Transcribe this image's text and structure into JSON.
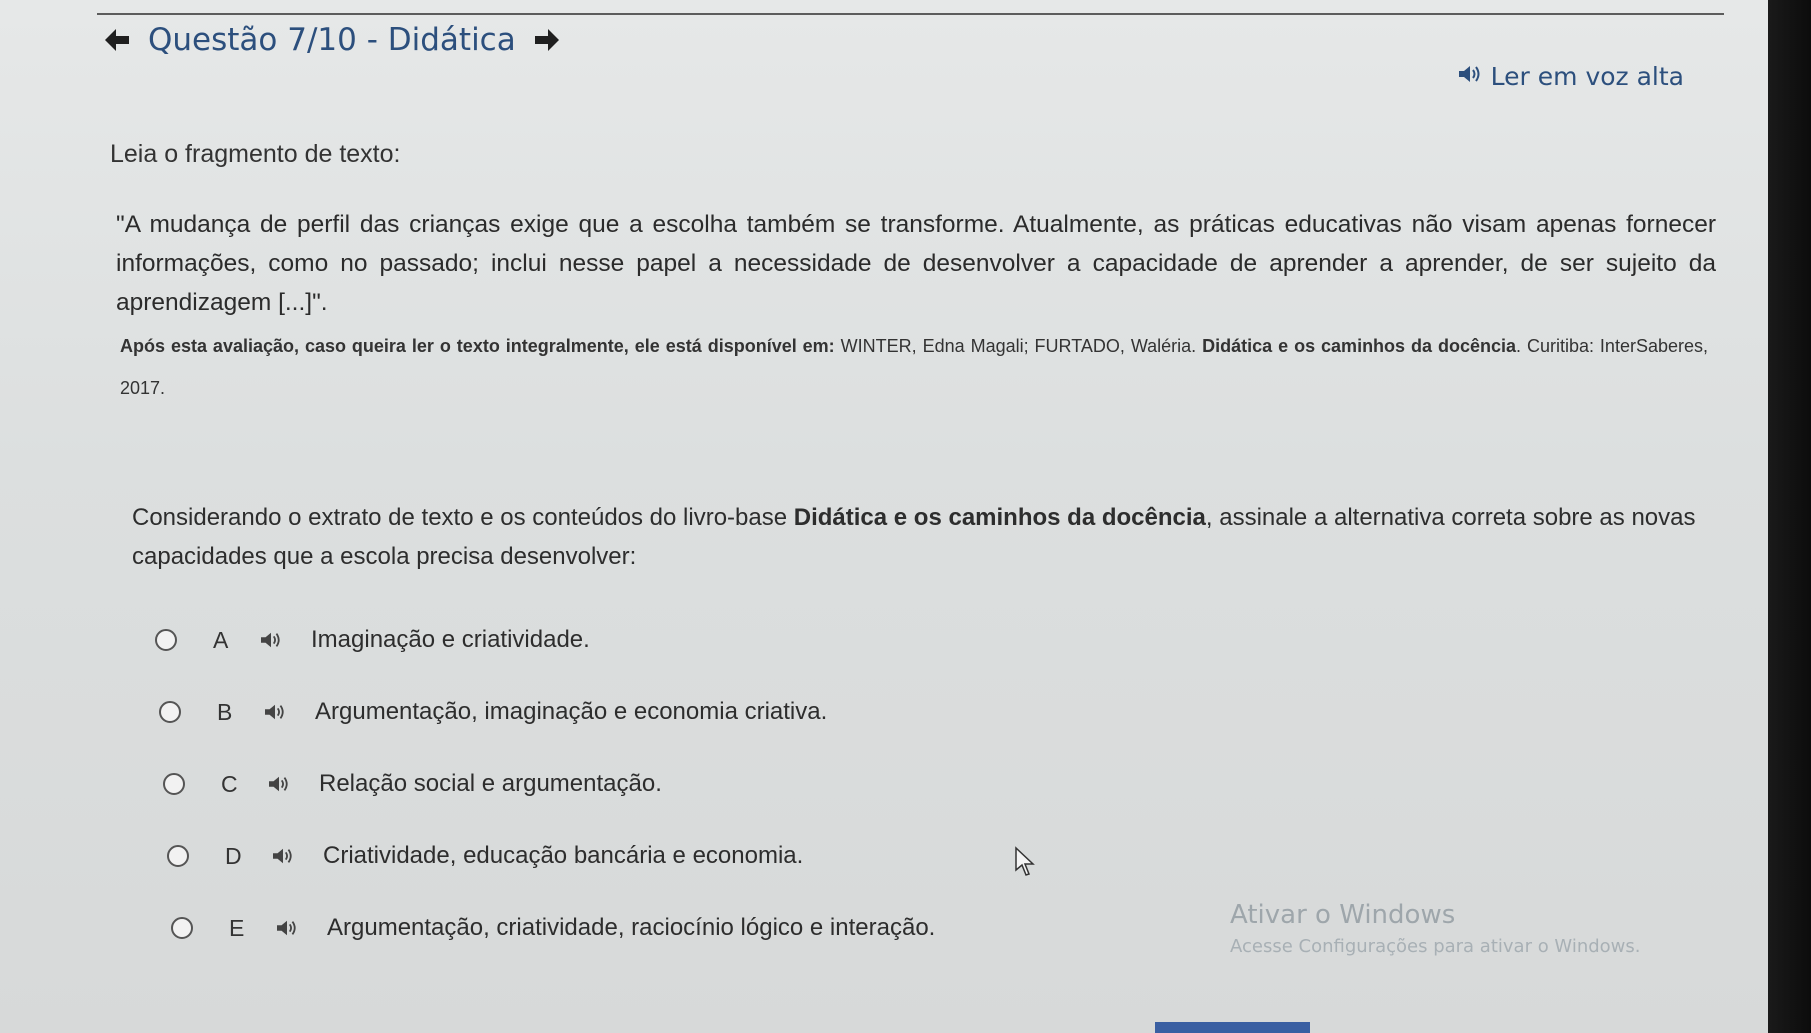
{
  "header": {
    "title": "Questão 7/10 - Didática",
    "prev_icon": "arrow-left-icon",
    "next_icon": "arrow-right-icon"
  },
  "read_aloud": {
    "label": "Ler em voz alta",
    "icon": "speaker-icon"
  },
  "question": {
    "intro": "Leia o fragmento de texto:",
    "quote": "\"A mudança de perfil das crianças exige que a escolha também se transforme. Atualmente, as práticas educativas não visam apenas fornecer informações, como no passado; inclui nesse papel a necessidade de desenvolver a capacidade de aprender a aprender, de ser sujeito da aprendizagem [...]\".",
    "source_bold": "Após esta avaliação, caso queira ler o texto integralmente, ele está disponível em:",
    "source_plain": " WINTER, Edna Magali; FURTADO, Waléria. ",
    "source_title": "Didática e os caminhos da docência",
    "source_end": ". Curitiba: InterSaberes, 2017.",
    "statement_start": "Considerando o extrato de texto e os conteúdos do livro-base ",
    "statement_bold": "Didática e os caminhos da docência",
    "statement_end": ", assinale a alternativa correta sobre as novas capacidades que a escola precisa desenvolver:"
  },
  "alternatives": [
    {
      "letter": "A",
      "text": "Imaginação e criatividade."
    },
    {
      "letter": "B",
      "text": "Argumentação, imaginação e economia criativa."
    },
    {
      "letter": "C",
      "text": "Relação social e argumentação."
    },
    {
      "letter": "D",
      "text": "Criatividade, educação bancária e economia."
    },
    {
      "letter": "E",
      "text": "Argumentação, criatividade, raciocínio lógico e interação."
    }
  ],
  "watermark": {
    "title": "Ativar o Windows",
    "subtitle": "Acesse Configurações para ativar o Windows."
  },
  "colors": {
    "accent": "#2c4f7d",
    "text": "#2d2d2d",
    "background": "#dcdfdf"
  }
}
